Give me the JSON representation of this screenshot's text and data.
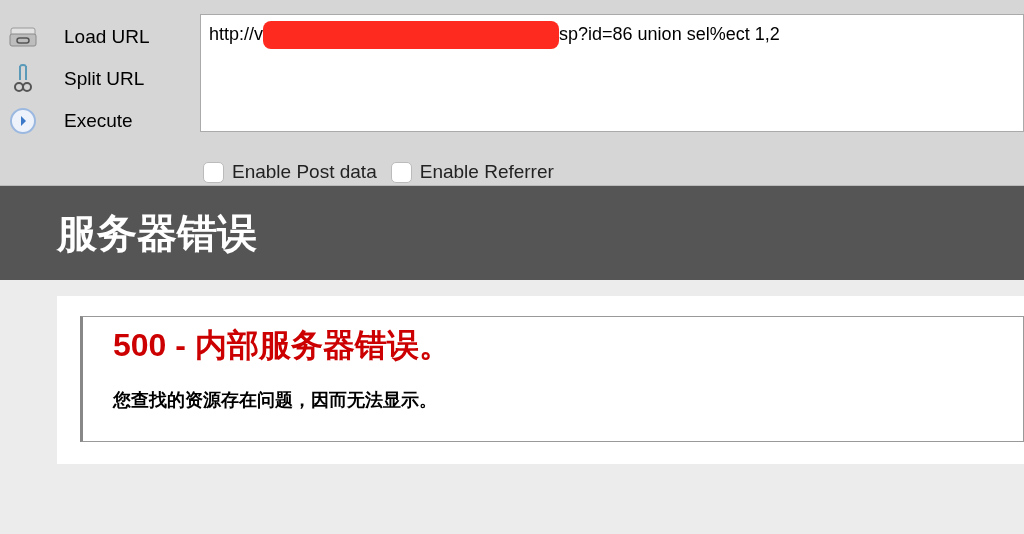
{
  "toolbar": {
    "buttons": [
      {
        "kind": "load",
        "label": "Load URL"
      },
      {
        "kind": "split",
        "label": "Split URL"
      },
      {
        "kind": "execute",
        "label": "Execute"
      }
    ],
    "url": {
      "before": "http://v",
      "after": "sp?id=86 union sel%ect 1,2"
    },
    "options": [
      {
        "label": "Enable Post data",
        "checked": false
      },
      {
        "label": "Enable Referrer",
        "checked": false
      }
    ]
  },
  "page": {
    "header": "服务器错误",
    "error_title": "500 - 内部服务器错误。",
    "error_message": "您查找的资源存在问题，因而无法显示。"
  }
}
